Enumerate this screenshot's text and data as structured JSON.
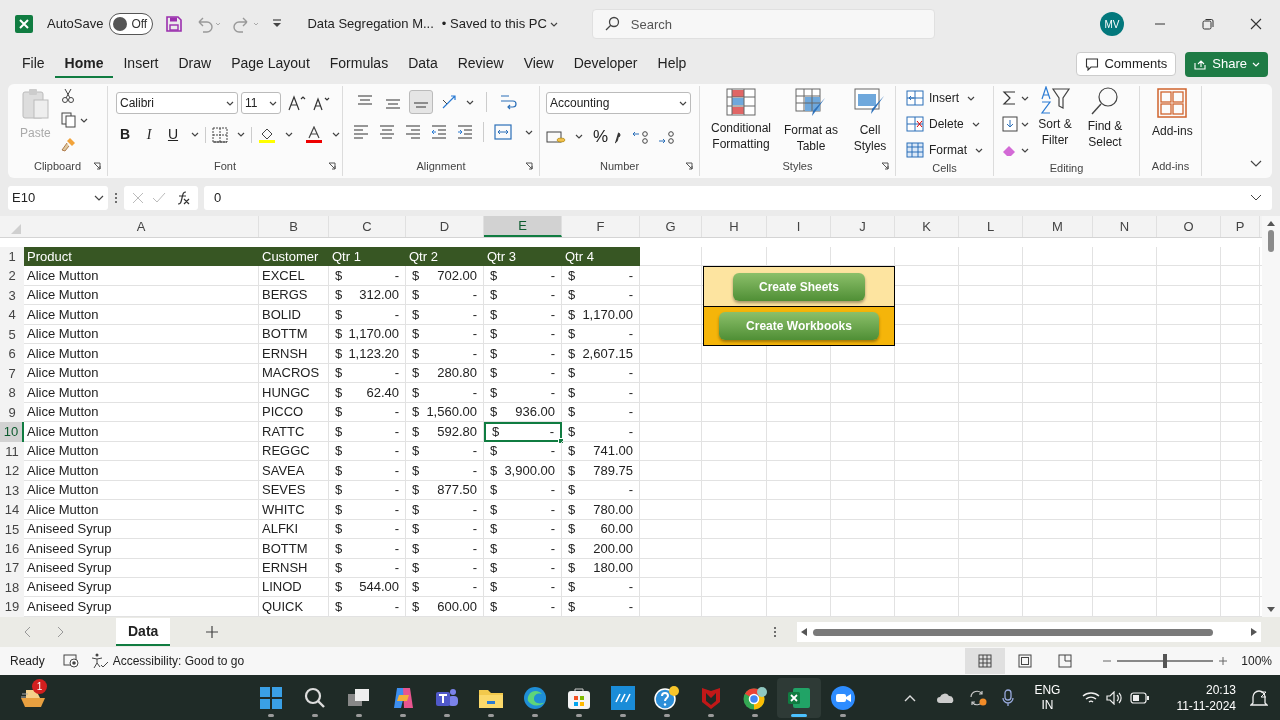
{
  "title_bar": {
    "autosave": {
      "label": "AutoSave",
      "state": "Off",
      "on": false
    },
    "document_title": "Data Segregation M...",
    "save_status": "• Saved to this PC",
    "search": {
      "placeholder": "Search"
    },
    "account_initials": "MV"
  },
  "menu_tabs": [
    {
      "label": "File",
      "selected": false
    },
    {
      "label": "Home",
      "selected": true
    },
    {
      "label": "Insert",
      "selected": false
    },
    {
      "label": "Draw",
      "selected": false
    },
    {
      "label": "Page Layout",
      "selected": false
    },
    {
      "label": "Formulas",
      "selected": false
    },
    {
      "label": "Data",
      "selected": false
    },
    {
      "label": "Review",
      "selected": false
    },
    {
      "label": "View",
      "selected": false
    },
    {
      "label": "Developer",
      "selected": false
    },
    {
      "label": "Help",
      "selected": false
    }
  ],
  "comments_button": "Comments",
  "share_button": "Share",
  "ribbon": {
    "clipboard": {
      "label": "Clipboard",
      "paste": "Paste",
      "paste_disabled": true
    },
    "font": {
      "label": "Font",
      "font_name": "Calibri",
      "font_size": "11",
      "bold": "B",
      "italic": "I",
      "underline": "U"
    },
    "alignment": {
      "label": "Alignment",
      "vertical_align": [
        {
          "selected": false
        },
        {
          "selected": false
        },
        {
          "selected": true
        }
      ]
    },
    "number": {
      "label": "Number",
      "format": "Accounting",
      "percent": "%"
    },
    "styles": {
      "label": "Styles",
      "buttons": [
        "Conditional Formatting",
        "Format as Table",
        "Cell Styles"
      ]
    },
    "cells": {
      "label": "Cells",
      "buttons": [
        "Insert",
        "Delete",
        "Format"
      ]
    },
    "editing": {
      "label": "Editing",
      "buttons": [
        "Sort & Filter",
        "Find & Select"
      ]
    },
    "addins": {
      "label": "Add-ins",
      "button": "Add-ins"
    }
  },
  "formula_bar": {
    "name_box": "E10",
    "value": "0"
  },
  "sheet": {
    "columns": [
      {
        "label": "A",
        "selected": false
      },
      {
        "label": "B",
        "selected": false
      },
      {
        "label": "C",
        "selected": false
      },
      {
        "label": "D",
        "selected": false
      },
      {
        "label": "E",
        "selected": true
      },
      {
        "label": "F",
        "selected": false
      },
      {
        "label": "G",
        "selected": false
      },
      {
        "label": "H",
        "selected": false
      },
      {
        "label": "I",
        "selected": false
      },
      {
        "label": "J",
        "selected": false
      },
      {
        "label": "K",
        "selected": false
      },
      {
        "label": "L",
        "selected": false
      },
      {
        "label": "M",
        "selected": false
      },
      {
        "label": "N",
        "selected": false
      },
      {
        "label": "O",
        "selected": false
      },
      {
        "label": "P",
        "selected": false
      }
    ],
    "header_row": {
      "number": "1",
      "cells": [
        "Product",
        "Customer",
        "Qtr 1",
        "Qtr 2",
        "Qtr 3",
        "Qtr 4"
      ]
    },
    "rows": [
      {
        "number": "2",
        "selected": false,
        "product": "Alice Mutton",
        "customer": "EXCEL",
        "quarters": [
          {
            "currency": "$",
            "amount": "-",
            "selected": false
          },
          {
            "currency": "$",
            "amount": "702.00",
            "selected": false
          },
          {
            "currency": "$",
            "amount": "-",
            "selected": false
          },
          {
            "currency": "$",
            "amount": "-",
            "selected": false
          }
        ]
      },
      {
        "number": "3",
        "selected": false,
        "product": "Alice Mutton",
        "customer": "BERGS",
        "quarters": [
          {
            "currency": "$",
            "amount": "312.00",
            "selected": false
          },
          {
            "currency": "$",
            "amount": "-",
            "selected": false
          },
          {
            "currency": "$",
            "amount": "-",
            "selected": false
          },
          {
            "currency": "$",
            "amount": "-",
            "selected": false
          }
        ]
      },
      {
        "number": "4",
        "selected": false,
        "product": "Alice Mutton",
        "customer": "BOLID",
        "quarters": [
          {
            "currency": "$",
            "amount": "-",
            "selected": false
          },
          {
            "currency": "$",
            "amount": "-",
            "selected": false
          },
          {
            "currency": "$",
            "amount": "-",
            "selected": false
          },
          {
            "currency": "$",
            "amount": "1,170.00",
            "selected": false
          }
        ]
      },
      {
        "number": "5",
        "selected": false,
        "product": "Alice Mutton",
        "customer": "BOTTM",
        "quarters": [
          {
            "currency": "$",
            "amount": "1,170.00",
            "selected": false
          },
          {
            "currency": "$",
            "amount": "-",
            "selected": false
          },
          {
            "currency": "$",
            "amount": "-",
            "selected": false
          },
          {
            "currency": "$",
            "amount": "-",
            "selected": false
          }
        ]
      },
      {
        "number": "6",
        "selected": false,
        "product": "Alice Mutton",
        "customer": "ERNSH",
        "quarters": [
          {
            "currency": "$",
            "amount": "1,123.20",
            "selected": false
          },
          {
            "currency": "$",
            "amount": "-",
            "selected": false
          },
          {
            "currency": "$",
            "amount": "-",
            "selected": false
          },
          {
            "currency": "$",
            "amount": "2,607.15",
            "selected": false
          }
        ]
      },
      {
        "number": "7",
        "selected": false,
        "product": "Alice Mutton",
        "customer": "MACROS",
        "quarters": [
          {
            "currency": "$",
            "amount": "-",
            "selected": false
          },
          {
            "currency": "$",
            "amount": "280.80",
            "selected": false
          },
          {
            "currency": "$",
            "amount": "-",
            "selected": false
          },
          {
            "currency": "$",
            "amount": "-",
            "selected": false
          }
        ]
      },
      {
        "number": "8",
        "selected": false,
        "product": "Alice Mutton",
        "customer": "HUNGC",
        "quarters": [
          {
            "currency": "$",
            "amount": "62.40",
            "selected": false
          },
          {
            "currency": "$",
            "amount": "-",
            "selected": false
          },
          {
            "currency": "$",
            "amount": "-",
            "selected": false
          },
          {
            "currency": "$",
            "amount": "-",
            "selected": false
          }
        ]
      },
      {
        "number": "9",
        "selected": false,
        "product": "Alice Mutton",
        "customer": "PICCO",
        "quarters": [
          {
            "currency": "$",
            "amount": "-",
            "selected": false
          },
          {
            "currency": "$",
            "amount": "1,560.00",
            "selected": false
          },
          {
            "currency": "$",
            "amount": "936.00",
            "selected": false
          },
          {
            "currency": "$",
            "amount": "-",
            "selected": false
          }
        ]
      },
      {
        "number": "10",
        "selected": true,
        "product": "Alice Mutton",
        "customer": "RATTC",
        "quarters": [
          {
            "currency": "$",
            "amount": "-",
            "selected": false
          },
          {
            "currency": "$",
            "amount": "592.80",
            "selected": false
          },
          {
            "currency": "$",
            "amount": "-",
            "selected": true
          },
          {
            "currency": "$",
            "amount": "-",
            "selected": false
          }
        ]
      },
      {
        "number": "11",
        "selected": false,
        "product": "Alice Mutton",
        "customer": "REGGC",
        "quarters": [
          {
            "currency": "$",
            "amount": "-",
            "selected": false
          },
          {
            "currency": "$",
            "amount": "-",
            "selected": false
          },
          {
            "currency": "$",
            "amount": "-",
            "selected": false
          },
          {
            "currency": "$",
            "amount": "741.00",
            "selected": false
          }
        ]
      },
      {
        "number": "12",
        "selected": false,
        "product": "Alice Mutton",
        "customer": "SAVEA",
        "quarters": [
          {
            "currency": "$",
            "amount": "-",
            "selected": false
          },
          {
            "currency": "$",
            "amount": "-",
            "selected": false
          },
          {
            "currency": "$",
            "amount": "3,900.00",
            "selected": false
          },
          {
            "currency": "$",
            "amount": "789.75",
            "selected": false
          }
        ]
      },
      {
        "number": "13",
        "selected": false,
        "product": "Alice Mutton",
        "customer": "SEVES",
        "quarters": [
          {
            "currency": "$",
            "amount": "-",
            "selected": false
          },
          {
            "currency": "$",
            "amount": "877.50",
            "selected": false
          },
          {
            "currency": "$",
            "amount": "-",
            "selected": false
          },
          {
            "currency": "$",
            "amount": "-",
            "selected": false
          }
        ]
      },
      {
        "number": "14",
        "selected": false,
        "product": "Alice Mutton",
        "customer": "WHITC",
        "quarters": [
          {
            "currency": "$",
            "amount": "-",
            "selected": false
          },
          {
            "currency": "$",
            "amount": "-",
            "selected": false
          },
          {
            "currency": "$",
            "amount": "-",
            "selected": false
          },
          {
            "currency": "$",
            "amount": "780.00",
            "selected": false
          }
        ]
      },
      {
        "number": "15",
        "selected": false,
        "product": "Aniseed Syrup",
        "customer": "ALFKI",
        "quarters": [
          {
            "currency": "$",
            "amount": "-",
            "selected": false
          },
          {
            "currency": "$",
            "amount": "-",
            "selected": false
          },
          {
            "currency": "$",
            "amount": "-",
            "selected": false
          },
          {
            "currency": "$",
            "amount": "60.00",
            "selected": false
          }
        ]
      },
      {
        "number": "16",
        "selected": false,
        "product": "Aniseed Syrup",
        "customer": "BOTTM",
        "quarters": [
          {
            "currency": "$",
            "amount": "-",
            "selected": false
          },
          {
            "currency": "$",
            "amount": "-",
            "selected": false
          },
          {
            "currency": "$",
            "amount": "-",
            "selected": false
          },
          {
            "currency": "$",
            "amount": "200.00",
            "selected": false
          }
        ]
      },
      {
        "number": "17",
        "selected": false,
        "product": "Aniseed Syrup",
        "customer": "ERNSH",
        "quarters": [
          {
            "currency": "$",
            "amount": "-",
            "selected": false
          },
          {
            "currency": "$",
            "amount": "-",
            "selected": false
          },
          {
            "currency": "$",
            "amount": "-",
            "selected": false
          },
          {
            "currency": "$",
            "amount": "180.00",
            "selected": false
          }
        ]
      },
      {
        "number": "18",
        "selected": false,
        "product": "Aniseed Syrup",
        "customer": "LINOD",
        "quarters": [
          {
            "currency": "$",
            "amount": "544.00",
            "selected": false
          },
          {
            "currency": "$",
            "amount": "-",
            "selected": false
          },
          {
            "currency": "$",
            "amount": "-",
            "selected": false
          },
          {
            "currency": "$",
            "amount": "-",
            "selected": false
          }
        ]
      },
      {
        "number": "19",
        "selected": false,
        "product": "Aniseed Syrup",
        "customer": "QUICK",
        "quarters": [
          {
            "currency": "$",
            "amount": "-",
            "selected": false
          },
          {
            "currency": "$",
            "amount": "600.00",
            "selected": false
          },
          {
            "currency": "$",
            "amount": "-",
            "selected": false
          },
          {
            "currency": "$",
            "amount": "-",
            "selected": false
          }
        ]
      }
    ],
    "macro_buttons": [
      {
        "label": "Create Sheets",
        "color": "#fde4a0"
      },
      {
        "label": "Create Workbooks",
        "color": "#f5b50a"
      }
    ]
  },
  "sheet_tabs": [
    {
      "label": "Data",
      "selected": true
    }
  ],
  "status_bar": {
    "mode": "Ready",
    "accessibility": "Accessibility: Good to go",
    "views": [
      {
        "selected": true
      },
      {
        "selected": false
      },
      {
        "selected": false
      }
    ],
    "zoom": {
      "level": 0.5,
      "reading": "100%"
    }
  },
  "taskbar": {
    "notification_count": "1",
    "apps": [
      {
        "kind": "start",
        "active": false
      },
      {
        "kind": "search",
        "active": false
      },
      {
        "kind": "taskview",
        "active": false
      },
      {
        "kind": "copilot",
        "active": false
      },
      {
        "kind": "teams",
        "active": false
      },
      {
        "kind": "explorer",
        "active": false
      },
      {
        "kind": "edge",
        "active": false
      },
      {
        "kind": "store",
        "active": false
      },
      {
        "kind": "myhp",
        "active": false
      },
      {
        "kind": "help",
        "active": false
      },
      {
        "kind": "mcafee",
        "active": false
      },
      {
        "kind": "chrome",
        "active": false
      },
      {
        "kind": "excel",
        "active": true
      },
      {
        "kind": "zoom",
        "active": false
      }
    ],
    "language": [
      "ENG",
      "IN"
    ],
    "time": "20:13",
    "date": "11-11-2024"
  }
}
